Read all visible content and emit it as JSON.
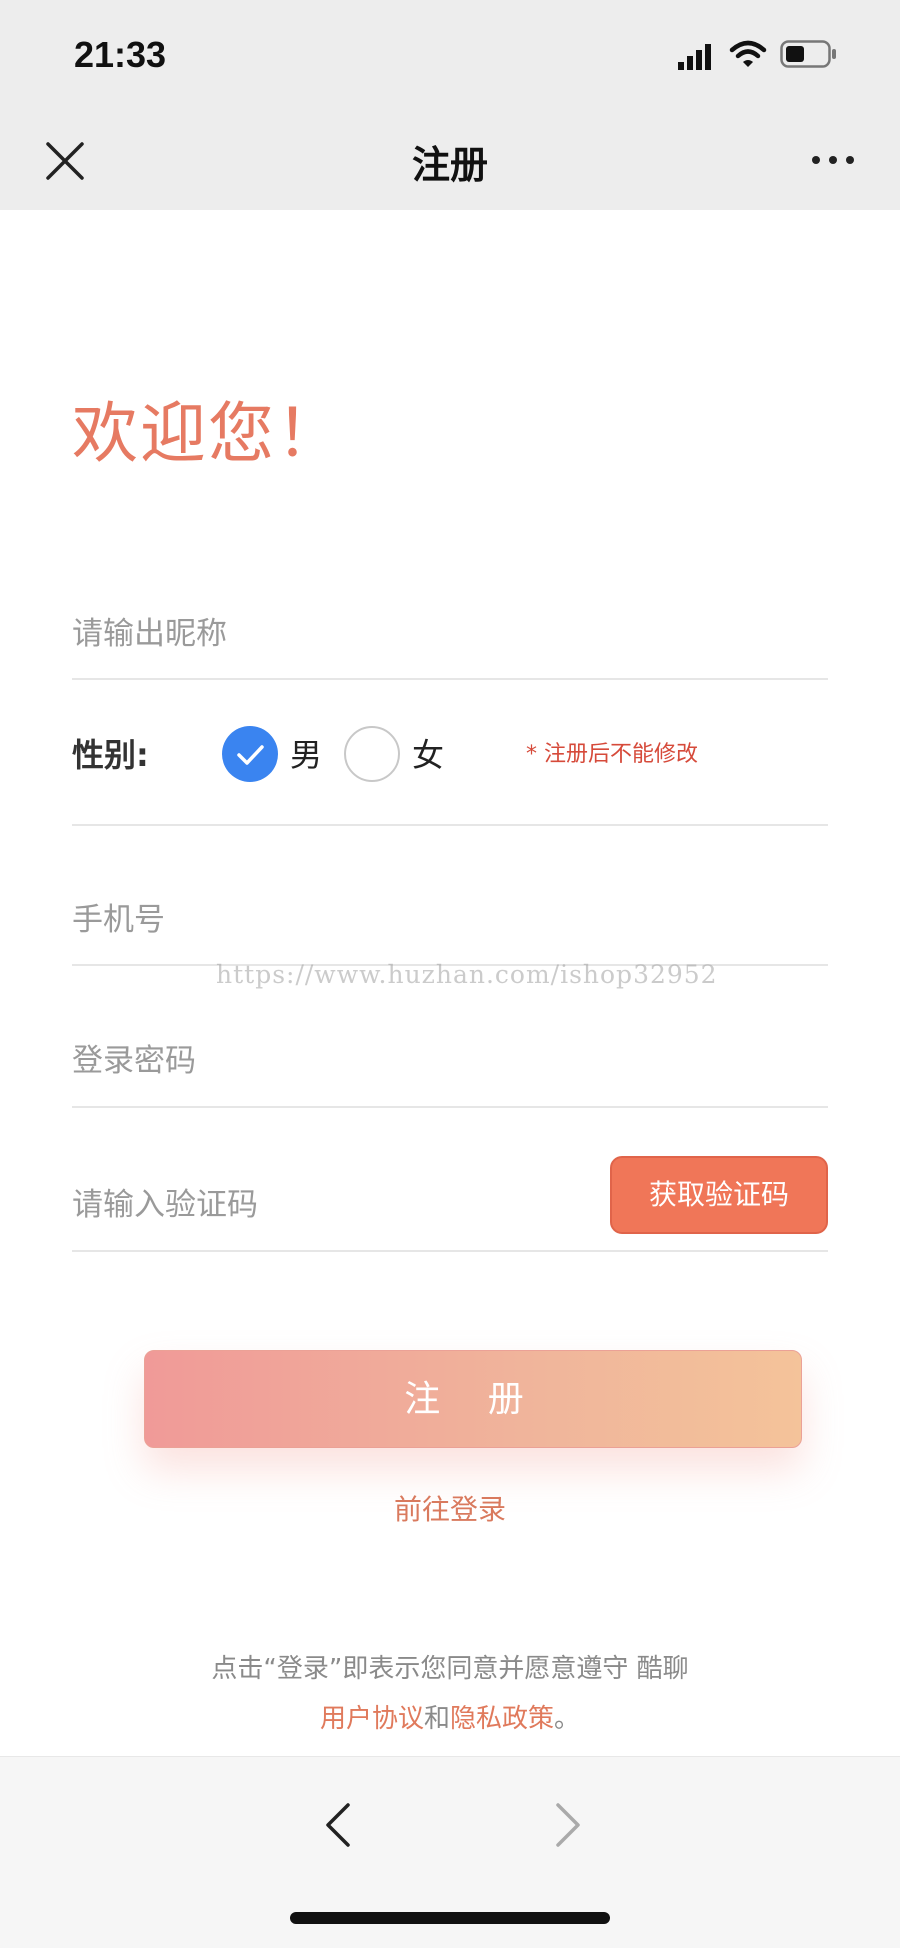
{
  "status_bar": {
    "time": "21:33"
  },
  "nav": {
    "title": "注册"
  },
  "welcome": "欢迎您！",
  "form": {
    "nickname_placeholder": "请输出昵称",
    "gender_label": "性别:",
    "gender_options": [
      "男",
      "女"
    ],
    "gender_selected": "男",
    "gender_note": "* 注册后不能修改",
    "phone_placeholder": "手机号",
    "password_placeholder": "登录密码",
    "code_placeholder": "请输入验证码",
    "get_code_label": "获取验证码",
    "register_label": "注 册",
    "goto_login": "前往登录"
  },
  "agreement": {
    "line1": "点击“登录”即表示您同意并愿意遵守 酷聊",
    "user_agreement": "用户协议",
    "and": "和",
    "privacy_policy": "隐私政策",
    "end": "。"
  },
  "watermark": "https://www.huzhan.com/ishop32952",
  "colors": {
    "accent": "#e67a62",
    "radio_selected": "#3a84f0",
    "code_button": "#f07658",
    "note_red": "#d64a3a"
  }
}
